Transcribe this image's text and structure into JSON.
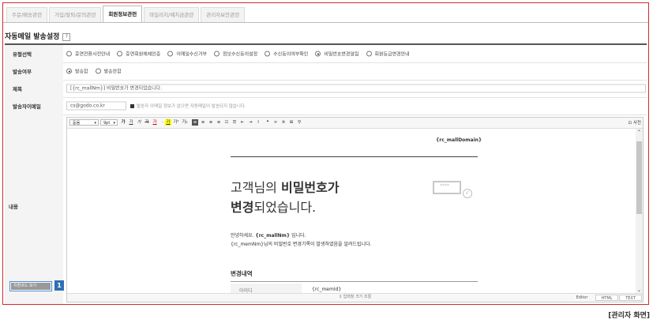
{
  "tabs": [
    "주문/배송관련",
    "가입/탈퇴/문의관련",
    "회원정보관련",
    "마일리지/예치금관련",
    "관리자보안관련"
  ],
  "section_title": "자동메일 발송설정",
  "help_icon": "?",
  "rows": {
    "type": {
      "label": "유형선택",
      "options": [
        "휴면전환사전안내",
        "휴면회원해제인증",
        "이메일수신거부",
        "정보수신동의설정",
        "수신동의여부확인",
        "비밀번호변경알림",
        "회원등급변경안내"
      ],
      "selected": "비밀번호변경알림"
    },
    "send": {
      "label": "발송여부",
      "options": [
        "발송함",
        "발송안함"
      ],
      "selected": "발송함"
    },
    "subject": {
      "label": "제목",
      "value": "[{rc_mallNm}] 비밀번호가 변경되었습니다."
    },
    "sender": {
      "label": "발송자이메일",
      "value": "cs@godo.co.kr",
      "hint": "발송자 이메일 정보가 없으면 자동메일이 발송되지 않습니다."
    },
    "content": {
      "label": "내용",
      "button": "치환코드 보기",
      "badge": "1"
    }
  },
  "editor": {
    "font_select": "돋움",
    "size_select": "9pt",
    "right_tool": "사전",
    "resize": "↕ 입력창 크기 조절",
    "modes": [
      "Editor",
      "HTML",
      "TEXT"
    ],
    "mail": {
      "domain": "{rc_mallDomain}",
      "headline_1a": "고객님의 ",
      "headline_1b": "비밀번호가",
      "headline_2a": "변경",
      "headline_2b": "되었습니다.",
      "env_stars": "****",
      "greeting_pre": "안녕하세요. ",
      "greeting_name": "{rc_mallNm}",
      "greeting_post": " 입니다.",
      "body": "{rc_memNm}님의 비밀번호 변경기록이 발생하였음을 알려드립니다.",
      "subhead": "변경내역",
      "table_label": "아이디",
      "table_value": "{rc_memId}"
    }
  },
  "caption": "[관리자 화면]",
  "colors": {
    "highlight_border": "#d12b2b",
    "badge": "#2f6fb5"
  }
}
